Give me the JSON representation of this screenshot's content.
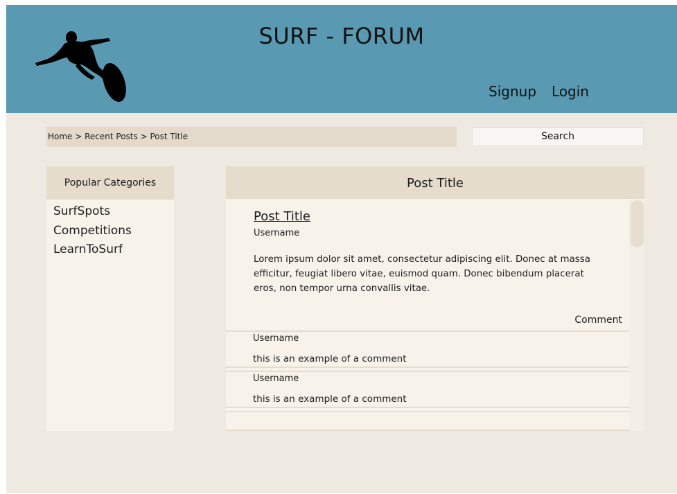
{
  "site": {
    "title": "SURF - FORUM",
    "logo_icon": "surfer-silhouette-icon"
  },
  "nav": {
    "signup_label": "Signup",
    "login_label": "Login"
  },
  "breadcrumb": {
    "text": "Home > Recent Posts > Post Title"
  },
  "search": {
    "label": "Search"
  },
  "categories": {
    "header": "Popular Categories",
    "items": [
      {
        "label": "SurfSpots"
      },
      {
        "label": "Competitions"
      },
      {
        "label": "LearnToSurf"
      }
    ]
  },
  "post": {
    "panel_title": "Post Title",
    "title": "Post Title",
    "username": "Username",
    "body": "Lorem ipsum dolor sit amet, consectetur adipiscing elit. Donec at massa efficitur, feugiat libero vitae, euismod quam. Donec bibendum placerat eros, non tempor urna convallis vitae.",
    "comment_label": "Comment"
  },
  "comments": [
    {
      "username": "Username",
      "text": "this is an example of a comment"
    },
    {
      "username": "Username",
      "text": "this is an example of a comment"
    }
  ],
  "colors": {
    "header": "#5999b1",
    "page": "#eeeae2",
    "panel": "#f8f3ea",
    "panel_header": "#e6dccc"
  }
}
